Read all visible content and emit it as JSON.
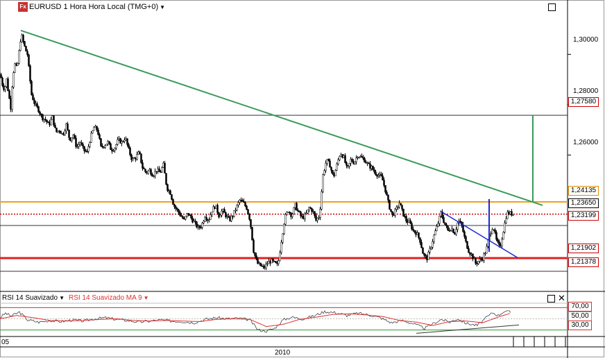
{
  "header": {
    "logo_text": "Fx",
    "title": "EURUSD 1 Hora Hora Local (TMG+0)"
  },
  "rsi_panel": {
    "indicator1": "RSI 14 Suavizado",
    "indicator2": "RSI 14 Suavizado MA 9",
    "levels": [
      "70,00",
      "50,00",
      "30,00"
    ]
  },
  "x_axis": {
    "left_label": "05",
    "year_label": "2010"
  },
  "price_axis": {
    "ticks": [
      "1,30000",
      "1,28000",
      "1,26000"
    ],
    "marked_levels": [
      {
        "label": "1,27580",
        "style": "red-box"
      },
      {
        "label": "1,24135",
        "style": "orange-box"
      },
      {
        "label": "1,23650",
        "style": "black-box"
      },
      {
        "label": "1,23199",
        "style": "red-box"
      },
      {
        "label": "1,21902",
        "style": "red-box"
      },
      {
        "label": "1,21378",
        "style": "red-box"
      }
    ]
  },
  "colors": {
    "trendline": "#3a9a5a",
    "orange_level": "#f0a020",
    "red_level": "#e02020",
    "blue_line": "#1a2ad0",
    "rsi_line": "#404040",
    "rsi_ma": "#e03030",
    "rsi_upper": "#cc3333",
    "rsi_lower": "#2a9a2a"
  },
  "chart_data": {
    "type": "candlestick",
    "symbol": "EURUSD",
    "timeframe": "1 Hora",
    "y_ticks": [
      1.3,
      1.28,
      1.26
    ],
    "ylim": [
      1.2058,
      1.3216
    ],
    "horizontal_levels": [
      1.2758,
      1.24135,
      1.2365,
      1.23199,
      1.21902,
      1.21378
    ],
    "price_path": [
      [
        0,
        1.292
      ],
      [
        3,
        1.288
      ],
      [
        6,
        1.286
      ],
      [
        9,
        1.29
      ],
      [
        12,
        1.284
      ],
      [
        15,
        1.279
      ],
      [
        18,
        1.292
      ],
      [
        21,
        1.296
      ],
      [
        24,
        1.294
      ],
      [
        27,
        1.301
      ],
      [
        30,
        1.308
      ],
      [
        33,
        1.305
      ],
      [
        36,
        1.302
      ],
      [
        39,
        1.3
      ],
      [
        42,
        1.292
      ],
      [
        45,
        1.284
      ],
      [
        50,
        1.28
      ],
      [
        55,
        1.278
      ],
      [
        60,
        1.275
      ],
      [
        65,
        1.274
      ],
      [
        70,
        1.272
      ],
      [
        75,
        1.275
      ],
      [
        80,
        1.269
      ],
      [
        85,
        1.27
      ],
      [
        90,
        1.268
      ],
      [
        95,
        1.272
      ],
      [
        100,
        1.266
      ],
      [
        105,
        1.268
      ],
      [
        110,
        1.263
      ],
      [
        115,
        1.265
      ],
      [
        120,
        1.262
      ],
      [
        125,
        1.261
      ],
      [
        130,
        1.267
      ],
      [
        135,
        1.271
      ],
      [
        140,
        1.27
      ],
      [
        145,
        1.263
      ],
      [
        150,
        1.264
      ],
      [
        155,
        1.265
      ],
      [
        160,
        1.262
      ],
      [
        165,
        1.263
      ],
      [
        170,
        1.266
      ],
      [
        175,
        1.265
      ],
      [
        180,
        1.267
      ],
      [
        185,
        1.262
      ],
      [
        190,
        1.258
      ],
      [
        195,
        1.259
      ],
      [
        200,
        1.261
      ],
      [
        205,
        1.255
      ],
      [
        210,
        1.253
      ],
      [
        215,
        1.254
      ],
      [
        220,
        1.252
      ],
      [
        225,
        1.254
      ],
      [
        230,
        1.253
      ],
      [
        235,
        1.256
      ],
      [
        240,
        1.247
      ],
      [
        245,
        1.245
      ],
      [
        250,
        1.24
      ],
      [
        255,
        1.238
      ],
      [
        260,
        1.236
      ],
      [
        265,
        1.234
      ],
      [
        270,
        1.237
      ],
      [
        275,
        1.235
      ],
      [
        280,
        1.233
      ],
      [
        285,
        1.231
      ],
      [
        290,
        1.232
      ],
      [
        295,
        1.236
      ],
      [
        300,
        1.234
      ],
      [
        305,
        1.238
      ],
      [
        310,
        1.24
      ],
      [
        315,
        1.236
      ],
      [
        320,
        1.238
      ],
      [
        325,
        1.236
      ],
      [
        330,
        1.234
      ],
      [
        335,
        1.236
      ],
      [
        340,
        1.239
      ],
      [
        345,
        1.242
      ],
      [
        350,
        1.241
      ],
      [
        355,
        1.239
      ],
      [
        360,
        1.234
      ],
      [
        365,
        1.222
      ],
      [
        370,
        1.217
      ],
      [
        375,
        1.216
      ],
      [
        380,
        1.215
      ],
      [
        385,
        1.217
      ],
      [
        390,
        1.218
      ],
      [
        395,
        1.217
      ],
      [
        400,
        1.216
      ],
      [
        405,
        1.226
      ],
      [
        410,
        1.235
      ],
      [
        415,
        1.238
      ],
      [
        420,
        1.236
      ],
      [
        425,
        1.24
      ],
      [
        430,
        1.237
      ],
      [
        435,
        1.235
      ],
      [
        440,
        1.236
      ],
      [
        445,
        1.239
      ],
      [
        450,
        1.238
      ],
      [
        455,
        1.234
      ],
      [
        460,
        1.236
      ],
      [
        465,
        1.252
      ],
      [
        470,
        1.258
      ],
      [
        475,
        1.256
      ],
      [
        480,
        1.251
      ],
      [
        485,
        1.256
      ],
      [
        490,
        1.261
      ],
      [
        495,
        1.259
      ],
      [
        500,
        1.254
      ],
      [
        505,
        1.258
      ],
      [
        510,
        1.257
      ],
      [
        515,
        1.26
      ],
      [
        520,
        1.259
      ],
      [
        525,
        1.258
      ],
      [
        530,
        1.256
      ],
      [
        535,
        1.255
      ],
      [
        540,
        1.253
      ],
      [
        545,
        1.252
      ],
      [
        550,
        1.251
      ],
      [
        555,
        1.246
      ],
      [
        560,
        1.24
      ],
      [
        565,
        1.236
      ],
      [
        570,
        1.238
      ],
      [
        575,
        1.241
      ],
      [
        580,
        1.237
      ],
      [
        585,
        1.234
      ],
      [
        590,
        1.233
      ],
      [
        595,
        1.23
      ],
      [
        600,
        1.229
      ],
      [
        605,
        1.226
      ],
      [
        610,
        1.22
      ],
      [
        615,
        1.219
      ],
      [
        620,
        1.223
      ],
      [
        625,
        1.228
      ],
      [
        630,
        1.232
      ],
      [
        635,
        1.237
      ],
      [
        640,
        1.233
      ],
      [
        645,
        1.23
      ],
      [
        650,
        1.231
      ],
      [
        655,
        1.229
      ],
      [
        660,
        1.234
      ],
      [
        665,
        1.232
      ],
      [
        670,
        1.226
      ],
      [
        675,
        1.222
      ],
      [
        680,
        1.22
      ],
      [
        685,
        1.217
      ],
      [
        690,
        1.218
      ],
      [
        695,
        1.219
      ],
      [
        700,
        1.222
      ],
      [
        705,
        1.228
      ],
      [
        710,
        1.232
      ],
      [
        715,
        1.226
      ],
      [
        720,
        1.223
      ],
      [
        725,
        1.23
      ],
      [
        730,
        1.237
      ],
      [
        735,
        1.2368
      ],
      [
        740,
        1.2365
      ]
    ],
    "trendline": {
      "from": [
        30,
        1.3095
      ],
      "to": [
        782,
        1.24
      ]
    },
    "projection": {
      "x": 768,
      "from": 1.2414,
      "to": 1.2758
    },
    "blue_trendline": {
      "from": [
        636,
        1.2375
      ],
      "to": [
        746,
        1.2192
      ]
    },
    "blue_spike": {
      "x": 705,
      "from": 1.2215,
      "to": 1.2425
    },
    "rsi": {
      "levels": [
        70,
        50,
        30
      ],
      "ylim": [
        22,
        78
      ],
      "values": [
        [
          0,
          52
        ],
        [
          8,
          60
        ],
        [
          16,
          55
        ],
        [
          28,
          62
        ],
        [
          40,
          48
        ],
        [
          56,
          44
        ],
        [
          72,
          47
        ],
        [
          88,
          45
        ],
        [
          104,
          48
        ],
        [
          120,
          46
        ],
        [
          136,
          50
        ],
        [
          152,
          52
        ],
        [
          168,
          49
        ],
        [
          184,
          47
        ],
        [
          200,
          44
        ],
        [
          216,
          46
        ],
        [
          232,
          48
        ],
        [
          248,
          46
        ],
        [
          264,
          45
        ],
        [
          280,
          43
        ],
        [
          296,
          49
        ],
        [
          312,
          52
        ],
        [
          328,
          50
        ],
        [
          344,
          51
        ],
        [
          360,
          48
        ],
        [
          372,
          30
        ],
        [
          384,
          28
        ],
        [
          396,
          33
        ],
        [
          408,
          48
        ],
        [
          420,
          53
        ],
        [
          436,
          50
        ],
        [
          452,
          55
        ],
        [
          468,
          63
        ],
        [
          484,
          61
        ],
        [
          500,
          56
        ],
        [
          516,
          60
        ],
        [
          532,
          57
        ],
        [
          548,
          52
        ],
        [
          564,
          43
        ],
        [
          580,
          47
        ],
        [
          596,
          41
        ],
        [
          612,
          33
        ],
        [
          624,
          41
        ],
        [
          636,
          49
        ],
        [
          648,
          44
        ],
        [
          660,
          50
        ],
        [
          672,
          42
        ],
        [
          688,
          38
        ],
        [
          700,
          51
        ],
        [
          710,
          61
        ],
        [
          718,
          56
        ],
        [
          726,
          63
        ],
        [
          736,
          62
        ]
      ],
      "ma_values": [
        [
          0,
          50
        ],
        [
          24,
          56
        ],
        [
          48,
          52
        ],
        [
          72,
          47
        ],
        [
          96,
          46
        ],
        [
          120,
          47
        ],
        [
          144,
          49
        ],
        [
          168,
          50
        ],
        [
          192,
          47
        ],
        [
          216,
          46
        ],
        [
          240,
          47
        ],
        [
          264,
          46
        ],
        [
          288,
          45
        ],
        [
          312,
          49
        ],
        [
          336,
          50
        ],
        [
          360,
          49
        ],
        [
          384,
          36
        ],
        [
          408,
          40
        ],
        [
          432,
          49
        ],
        [
          456,
          53
        ],
        [
          480,
          58
        ],
        [
          504,
          59
        ],
        [
          528,
          57
        ],
        [
          552,
          54
        ],
        [
          576,
          47
        ],
        [
          600,
          44
        ],
        [
          624,
          38
        ],
        [
          648,
          45
        ],
        [
          672,
          46
        ],
        [
          696,
          43
        ],
        [
          720,
          54
        ],
        [
          736,
          60
        ]
      ],
      "divergence_line": {
        "from": [
          600,
          24
        ],
        "to": [
          748,
          39
        ]
      }
    }
  }
}
